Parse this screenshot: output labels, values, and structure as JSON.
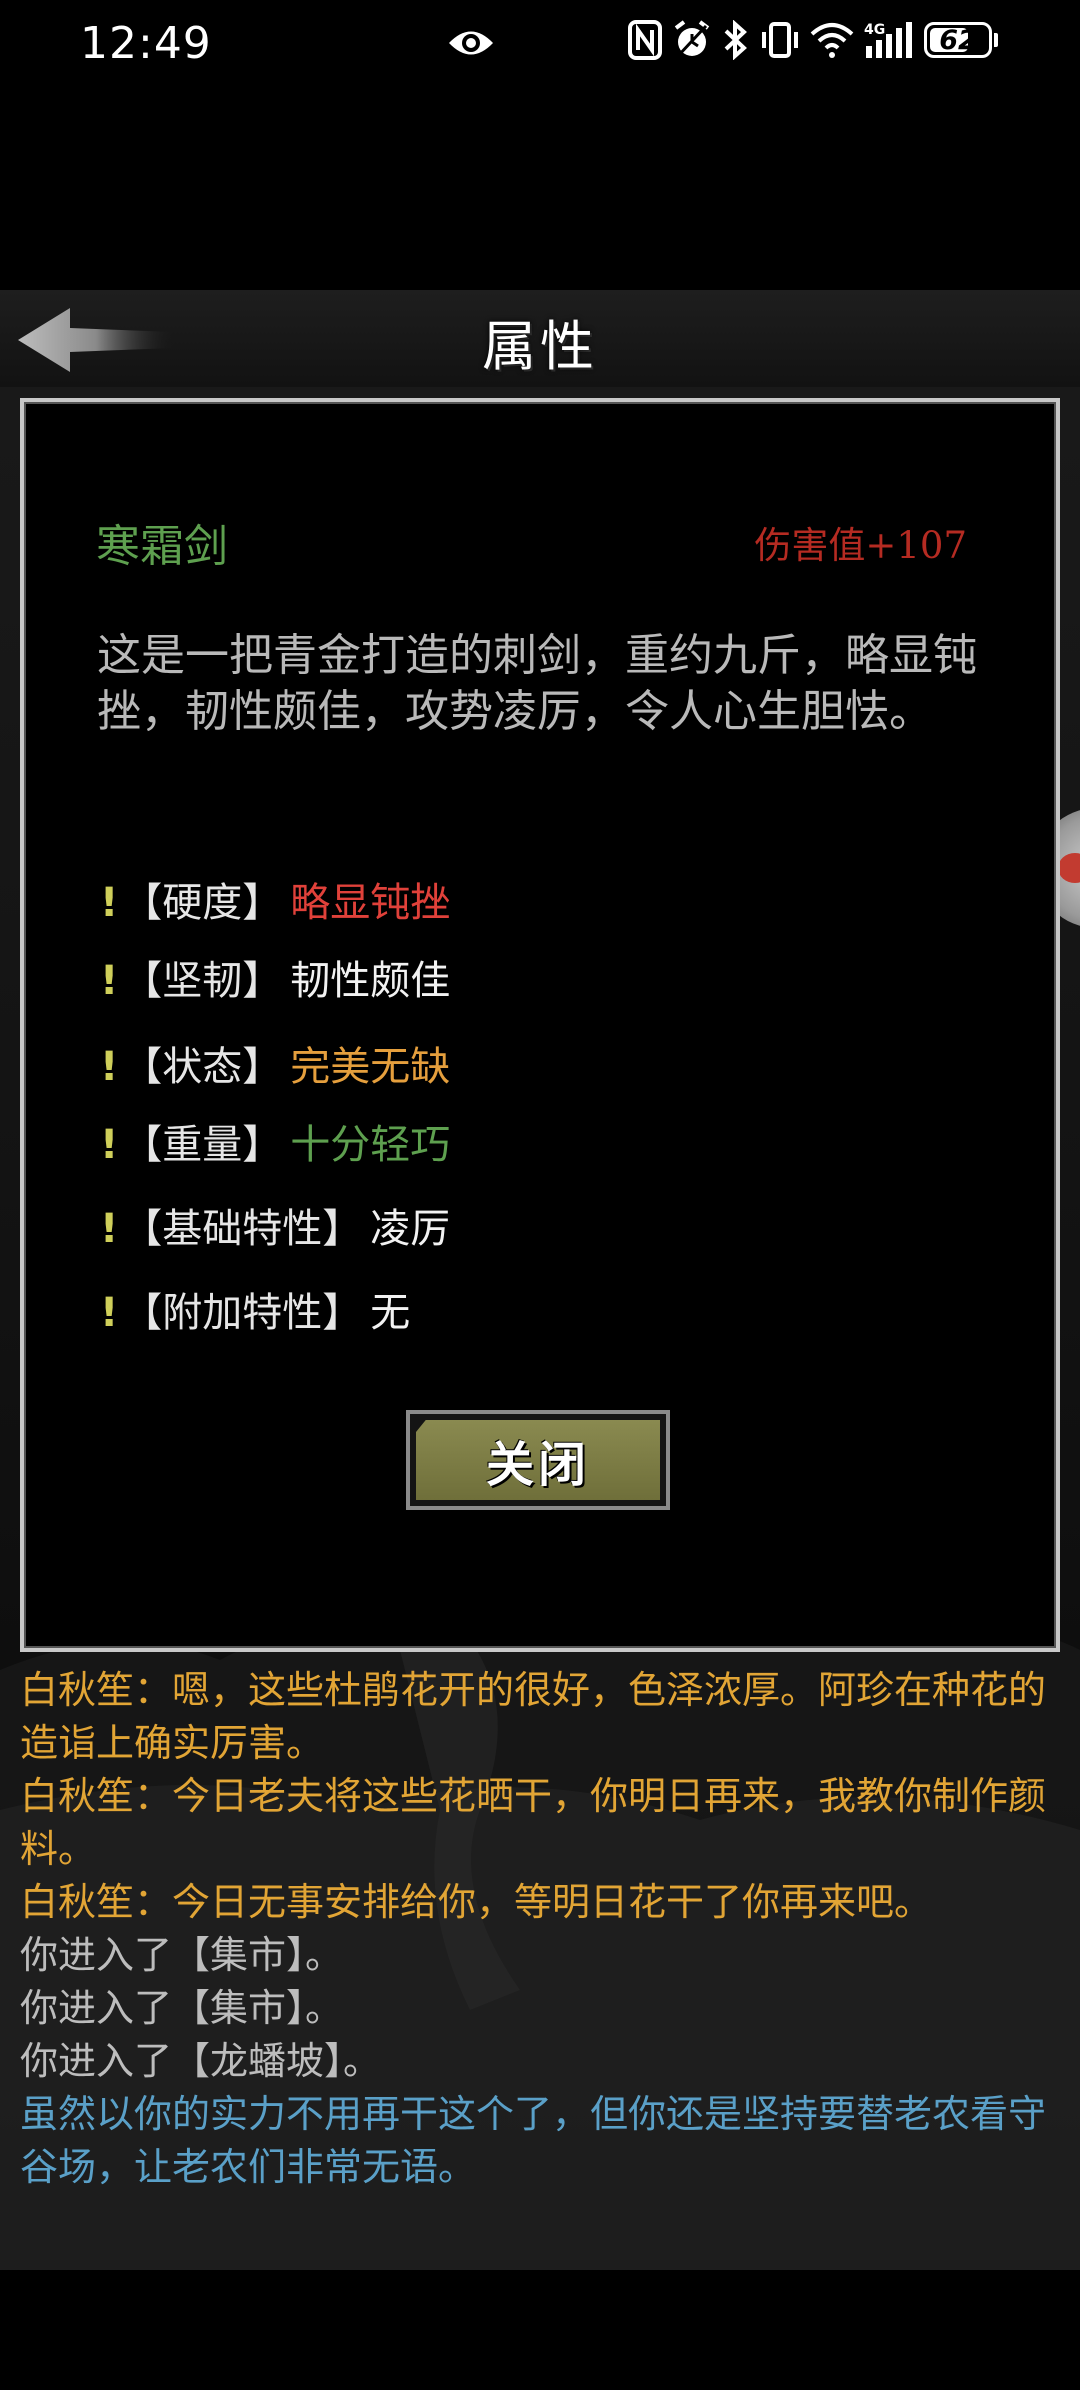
{
  "status_bar": {
    "time": "12:49",
    "battery": "62",
    "icons": [
      "eye-icon",
      "nfc-icon",
      "alarm-icon",
      "bluetooth-icon",
      "vibrate-icon",
      "wifi-icon",
      "signal-4g-icon",
      "battery-icon"
    ]
  },
  "header": {
    "title": "属性",
    "back_icon": "back-arrow-icon"
  },
  "item": {
    "name": "寒霜剑",
    "damage": "伤害值+107",
    "description": "这是一把青金打造的刺剑，重约九斤，略显钝挫，韧性颇佳，攻势凌厉，令人心生胆怯。",
    "attributes": [
      {
        "bang": "!",
        "key": "【硬度】",
        "value": "略显钝挫",
        "color": "#e0413a"
      },
      {
        "bang": "!",
        "key": "【坚韧】",
        "value": "韧性颇佳",
        "color": "#f2f2f2"
      },
      {
        "bang": "!",
        "key": "【状态】",
        "value": "完美无缺",
        "color": "#e59f3d"
      },
      {
        "bang": "!",
        "key": "【重量】",
        "value": "十分轻巧",
        "color": "#5ea04f"
      },
      {
        "bang": "!",
        "key": "【基础特性】",
        "value": "凌厉",
        "color": "#f2f2f2"
      },
      {
        "bang": "!",
        "key": "【附加特性】",
        "value": "无",
        "color": "#f2f2f2"
      }
    ],
    "close_label": "关闭"
  },
  "log": [
    {
      "text": "白秋笙：嗯，这些杜鹃花开的很好，色泽浓厚。阿珍在种花的造诣上确实厉害。",
      "color": "#e2a535"
    },
    {
      "text": "白秋笙：今日老夫将这些花晒干，你明日再来，我教你制作颜料。",
      "color": "#e2a535"
    },
    {
      "text": "白秋笙：今日无事安排给你，等明日花干了你再来吧。",
      "color": "#e2a535"
    },
    {
      "text": "你进入了【集市】。",
      "color": "#bdbdbd"
    },
    {
      "text": "你进入了【集市】。",
      "color": "#bdbdbd"
    },
    {
      "text": "你进入了【龙蟠坡】。",
      "color": "#bdbdbd"
    },
    {
      "text": "虽然以你的实力不用再干这个了，但你还是坚持要替老农看守谷场，让老农们非常无语。",
      "color": "#5aa0c8"
    }
  ]
}
